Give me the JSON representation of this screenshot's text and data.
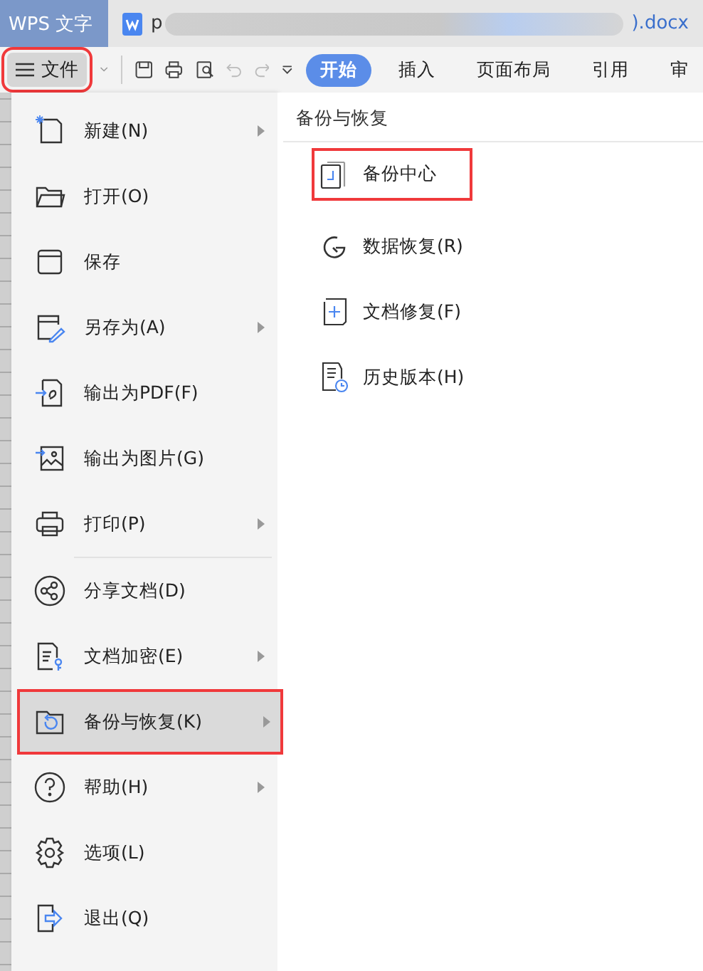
{
  "app_tab": {
    "label": "WPS 文字",
    "selected": true
  },
  "doc_tab": {
    "title_start": "p",
    "title_end": ").docx"
  },
  "file_button": {
    "label": "文件",
    "highlighted": true
  },
  "ribbon_tabs": [
    {
      "label": "开始",
      "selected": true
    },
    {
      "label": "插入",
      "selected": false
    },
    {
      "label": "页面布局",
      "selected": false
    },
    {
      "label": "引用",
      "selected": false
    },
    {
      "label": "审",
      "selected": false
    }
  ],
  "menu": [
    {
      "label": "新建(N)",
      "submenu": true,
      "selected": false,
      "highlighted": false
    },
    {
      "label": "打开(O)",
      "submenu": false,
      "selected": false,
      "highlighted": false
    },
    {
      "label": "保存",
      "submenu": false,
      "selected": false,
      "highlighted": false
    },
    {
      "label": "另存为(A)",
      "submenu": true,
      "selected": false,
      "highlighted": false
    },
    {
      "label": "输出为PDF(F)",
      "submenu": false,
      "selected": false,
      "highlighted": false
    },
    {
      "label": "输出为图片(G)",
      "submenu": false,
      "selected": false,
      "highlighted": false
    },
    {
      "label": "打印(P)",
      "submenu": true,
      "selected": false,
      "highlighted": false
    },
    {
      "label": "分享文档(D)",
      "submenu": false,
      "selected": false,
      "highlighted": false,
      "divider_before": true
    },
    {
      "label": "文档加密(E)",
      "submenu": true,
      "selected": false,
      "highlighted": false
    },
    {
      "label": "备份与恢复(K)",
      "submenu": true,
      "selected": true,
      "highlighted": true
    },
    {
      "label": "帮助(H)",
      "submenu": true,
      "selected": false,
      "highlighted": false
    },
    {
      "label": "选项(L)",
      "submenu": false,
      "selected": false,
      "highlighted": false
    },
    {
      "label": "退出(Q)",
      "submenu": false,
      "selected": false,
      "highlighted": false
    }
  ],
  "submenu": {
    "title": "备份与恢复",
    "items": [
      {
        "label": "备份中心",
        "highlighted": true
      },
      {
        "label": "数据恢复(R)",
        "highlighted": false
      },
      {
        "label": "文档修复(F)",
        "highlighted": false
      },
      {
        "label": "历史版本(H)",
        "highlighted": false
      }
    ]
  }
}
